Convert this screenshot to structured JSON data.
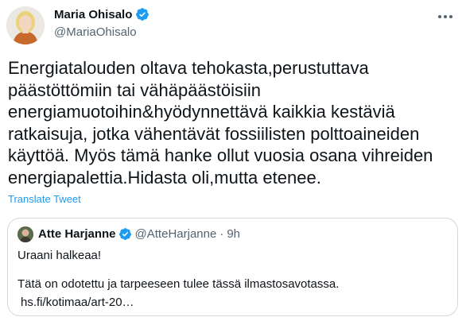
{
  "author": {
    "display_name": "Maria Ohisalo",
    "handle": "@MariaOhisalo",
    "avatar_icon": "profile-photo",
    "verified_icon": "verified-badge-icon"
  },
  "tweet": {
    "text": "Energiatalouden oltava tehokasta,perustuttava päästöttömiin tai vähäpäästöisiin energiamuotoihin&hyödynnettävä kaikkia kestäviä ratkaisuja, jotka vähentävät fossiilisten polttoaineiden käyttöä. Myös tämä hanke ollut vuosia osana vihreiden energiapalettia.Hidasta oli,mutta etenee.",
    "translate_label": "Translate Tweet"
  },
  "quoted": {
    "display_name": "Atte Harjanne",
    "handle": "@AtteHarjanne",
    "separator": "·",
    "time": "9h",
    "line1": "Uraani halkeaa!",
    "line2": "Tätä on odotettu ja tarpeeseen tulee tässä ilmastosavotassa.",
    "link": "hs.fi/kotimaa/art-20…"
  },
  "colors": {
    "accent": "#1d9bf0",
    "text": "#0f1419",
    "secondary": "#536471",
    "border": "#cfd9de"
  }
}
